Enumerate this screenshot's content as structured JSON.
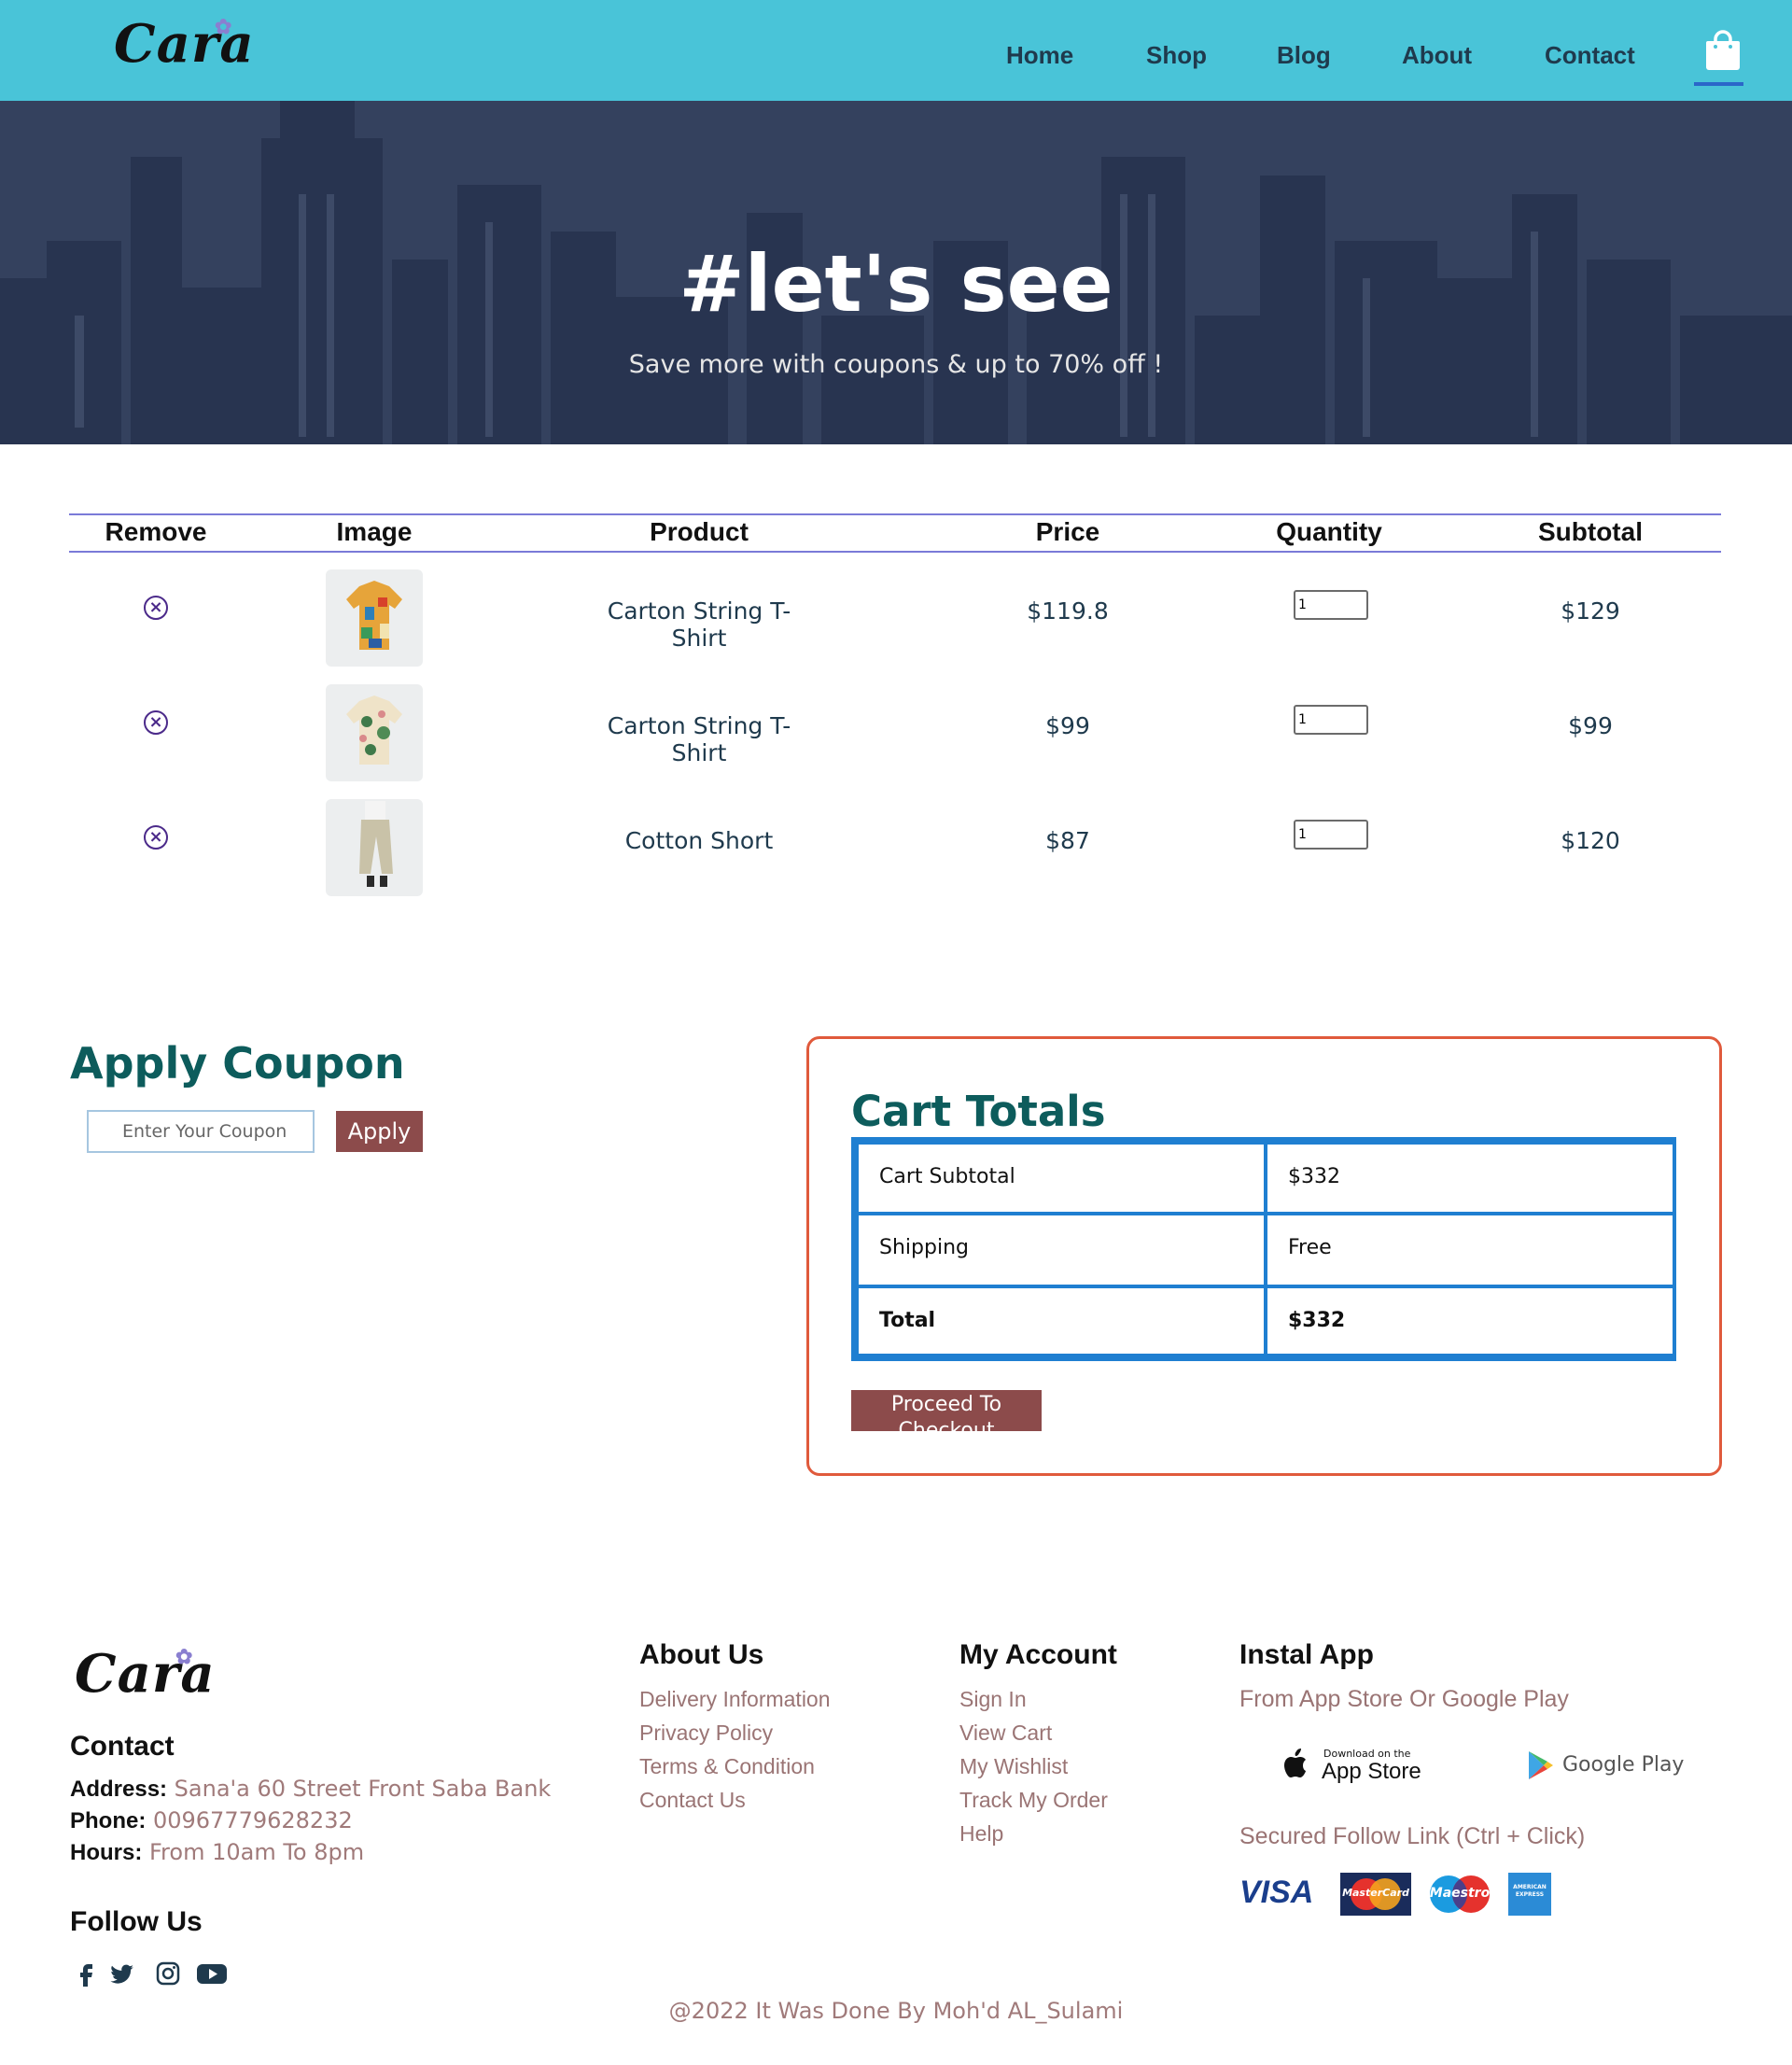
{
  "header": {
    "logo": "Cara",
    "nav": [
      "Home",
      "Shop",
      "Blog",
      "About",
      "Contact"
    ],
    "cart_icon": "shopping-bag-icon",
    "colors": {
      "bar": "#49c4d8",
      "active_underline": "#2a67c9"
    }
  },
  "hero": {
    "title": "#let's see",
    "subtitle": "Save more with coupons & up to 70% off !"
  },
  "cart": {
    "headers": [
      "Remove",
      "Image",
      "Product",
      "Price",
      "Quantity",
      "Subtotal"
    ],
    "rows": [
      {
        "product": "Carton String T-Shirt",
        "price": "$119.8",
        "quantity": "1",
        "subtotal": "$129"
      },
      {
        "product": "Carton String T-Shirt",
        "price": "$99",
        "quantity": "1",
        "subtotal": "$99"
      },
      {
        "product": "Cotton Short",
        "price": "$87",
        "quantity": "1",
        "subtotal": "$120"
      }
    ]
  },
  "coupon": {
    "title": "Apply Coupon",
    "placeholder": "Enter Your Coupon",
    "button": "Apply"
  },
  "totals": {
    "title": "Cart Totals",
    "rows": [
      {
        "label": "Cart Subtotal",
        "value": "$332"
      },
      {
        "label": "Shipping",
        "value": "Free"
      },
      {
        "label": "Total",
        "value": "$332"
      }
    ],
    "button": "Proceed To Checkout"
  },
  "footer": {
    "logo": "Cara",
    "contact_heading": "Contact",
    "address_label": "Address:",
    "address": "Sana'a 60 Street Front Saba Bank",
    "phone_label": "Phone:",
    "phone": "00967779628232",
    "hours_label": "Hours:",
    "hours": "From 10am To 8pm",
    "follow_heading": "Follow Us",
    "social": [
      "facebook-icon",
      "twitter-icon",
      "instagram-icon",
      "youtube-icon"
    ],
    "about_heading": "About Us",
    "about_links": [
      "Delivery Information",
      "Privacy Policy",
      "Terms & Condition",
      "Contact Us"
    ],
    "account_heading": "My Account",
    "account_links": [
      "Sign In",
      "View Cart",
      "My Wishlist",
      "Track My Order",
      "Help"
    ],
    "app_heading": "Instal App",
    "app_sub": "From App Store Or Google Play",
    "app_store_small": "Download on the",
    "app_store": "App Store",
    "google_play": "Google Play",
    "secured": "Secured Follow Link (Ctrl + Click)",
    "cards": [
      "VISA",
      "MasterCard",
      "Maestro",
      "AMERICAN EXPRESS"
    ],
    "copyright": "@2022 It Was Done By Moh'd AL_Sulami"
  }
}
